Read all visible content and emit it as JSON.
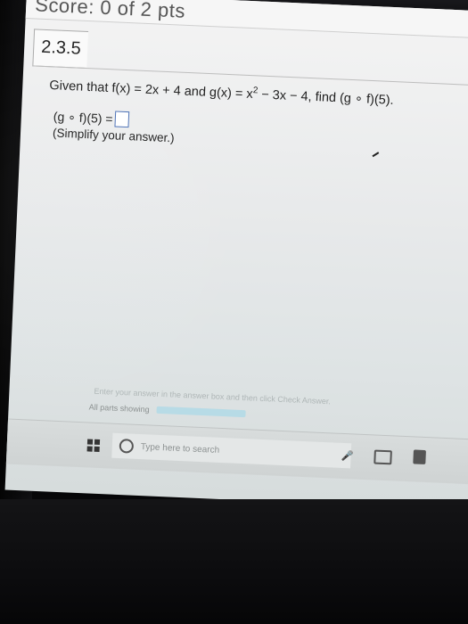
{
  "header": {
    "score_label": "Score: 0 of 2 pts"
  },
  "problem": {
    "number": "2.3.5",
    "question_pre": "Given that f(x) = 2x + 4 and g(x) = x",
    "question_exp": "2",
    "question_post": " − 3x − 4, find (g ∘ f)(5).",
    "answer_prefix": "(g ∘ f)(5) =",
    "hint": "(Simplify your answer.)"
  },
  "footer": {
    "instructions": "Enter your answer in the answer box and then click Check Answer.",
    "parts_label": "All parts showing"
  },
  "taskbar": {
    "search_placeholder": "Type here to search",
    "mic_glyph": "🎤"
  },
  "colors": {
    "answer_box_border": "#4a6fb5",
    "progress_fill": "#b7dbe6"
  }
}
